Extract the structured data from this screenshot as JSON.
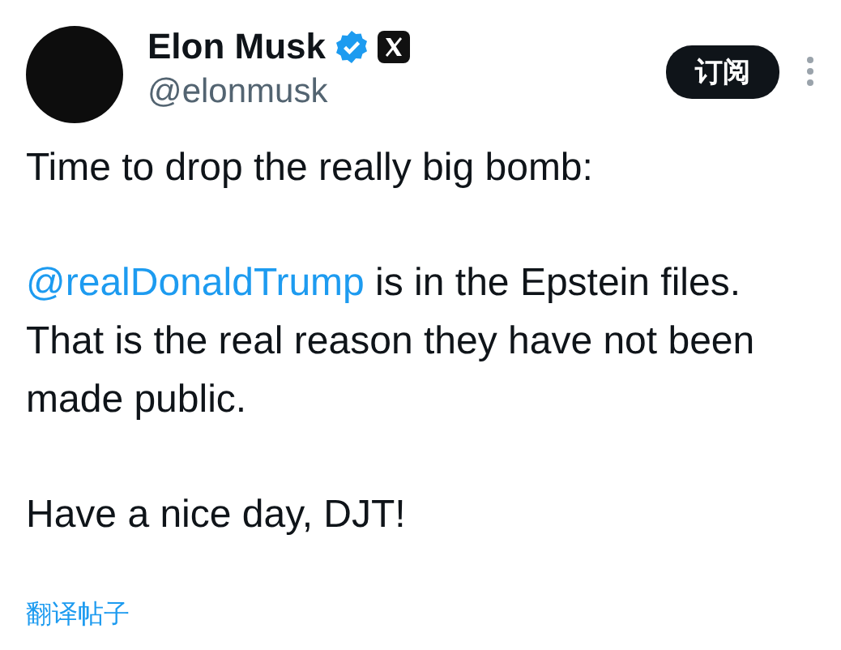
{
  "author": {
    "name": "Elon Musk",
    "handle": "@elonmusk",
    "verified": true
  },
  "subscribe_button": "订阅",
  "paragraphs": [
    {
      "kind": "plain",
      "text": "Time to drop the really big bomb:"
    },
    {
      "kind": "mention",
      "mention": "@realDonaldTrump",
      "text": "is in the Epstein files. That is the real reason they have not been made public."
    },
    {
      "kind": "plain",
      "text": "Have a nice day, DJT!"
    }
  ],
  "translate_link": "翻译帖子"
}
